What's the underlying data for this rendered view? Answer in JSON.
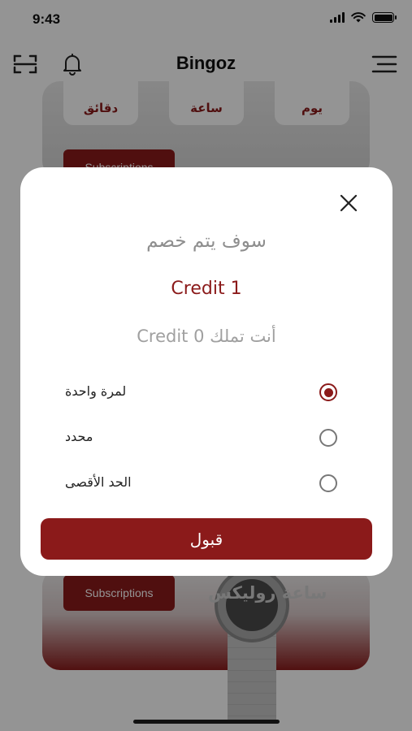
{
  "status_bar": {
    "time": "9:43",
    "signal_icon": "cellular-signal-icon",
    "wifi_icon": "wifi-icon",
    "battery_icon": "battery-icon"
  },
  "header": {
    "title": "Bingoz",
    "scan_icon": "scan-icon",
    "bell_icon": "bell-icon",
    "menu_icon": "menu-icon"
  },
  "background": {
    "timer_units": [
      "دقائق",
      "ساعة",
      "يوم"
    ],
    "subscribe_top_label": "Subscriptions",
    "subscribe_bottom_label": "Subscriptions",
    "item_title_bottom": "ساعة روليكس"
  },
  "modal": {
    "heading": "سوف يتم خصم",
    "credit_cost": "Credit 1",
    "credit_balance": "أنت تملك Credit 0",
    "options": [
      {
        "label": "لمرة واحدة",
        "selected": true
      },
      {
        "label": "محدد",
        "selected": false
      },
      {
        "label": "الحد الأقصى",
        "selected": false
      }
    ],
    "accept_label": "قبول",
    "close_icon": "close-icon"
  },
  "colors": {
    "accent": "#8b1a1a",
    "overlay": "rgba(0,0,0,0.42)"
  }
}
